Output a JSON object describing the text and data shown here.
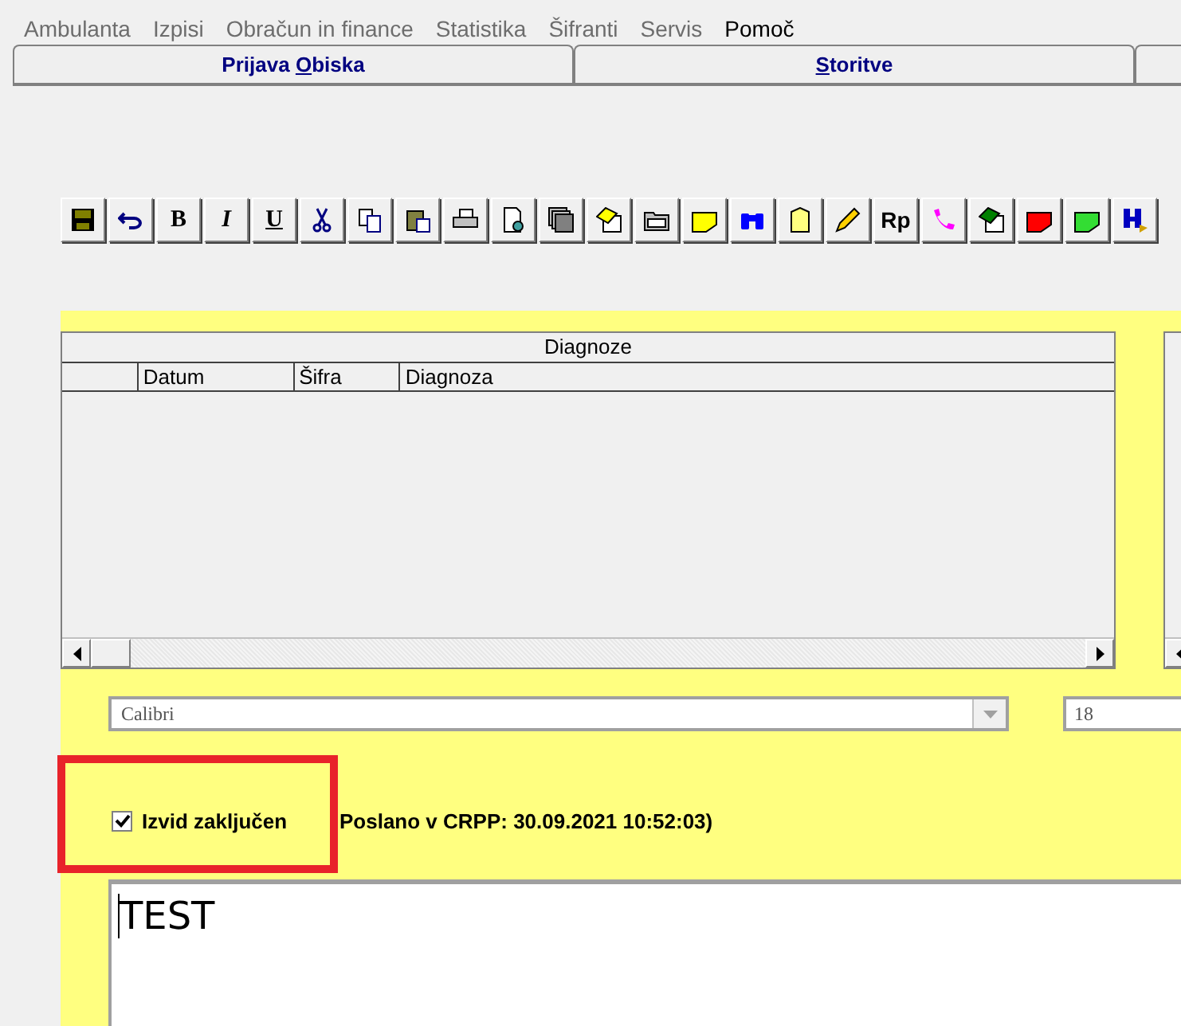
{
  "menu": [
    {
      "label": "Ambulanta",
      "disabled": true
    },
    {
      "label": "Izpisi",
      "disabled": true
    },
    {
      "label": "Obračun in finance",
      "disabled": true
    },
    {
      "label": "Statistika",
      "disabled": true
    },
    {
      "label": "Šifranti",
      "disabled": true
    },
    {
      "label": "Servis",
      "disabled": true
    },
    {
      "label": "Pomoč",
      "disabled": false
    }
  ],
  "tabs": [
    {
      "prefix": "Prijava ",
      "key": "O",
      "suffix": "biska"
    },
    {
      "key": "S",
      "suffix": "toritve"
    }
  ],
  "toolbar": [
    {
      "kind": "save"
    },
    {
      "kind": "undo"
    },
    {
      "kind": "text",
      "label": "B"
    },
    {
      "kind": "text",
      "label": "I"
    },
    {
      "kind": "text",
      "label": "U"
    },
    {
      "kind": "cut"
    },
    {
      "kind": "copy"
    },
    {
      "kind": "paste"
    },
    {
      "kind": "print"
    },
    {
      "kind": "preview"
    },
    {
      "kind": "stack"
    },
    {
      "kind": "note"
    },
    {
      "kind": "folder"
    },
    {
      "kind": "tag"
    },
    {
      "kind": "binoculars"
    },
    {
      "kind": "file"
    },
    {
      "kind": "pencil"
    },
    {
      "kind": "text",
      "label": "Rp"
    },
    {
      "kind": "phone"
    },
    {
      "kind": "note"
    },
    {
      "kind": "tag"
    },
    {
      "kind": "tag"
    },
    {
      "kind": "export"
    }
  ],
  "diagnoses": {
    "title": "Diagnoze",
    "columns": [
      "Datum",
      "Šifra",
      "Diagnoza"
    ]
  },
  "font_field": {
    "value": "Calibri"
  },
  "size_field": {
    "value": "18"
  },
  "closed_checkbox": {
    "label": "Izvid zaključen",
    "checked": true
  },
  "sent_note": "Poslano v CRPP: 30.09.2021 10:52:03)",
  "editor": {
    "value": "TEST"
  }
}
